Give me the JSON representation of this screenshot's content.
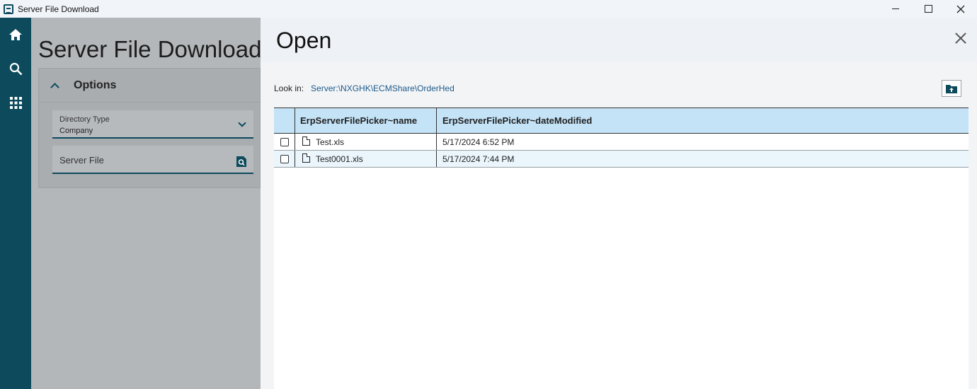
{
  "window": {
    "title": "Server File Download"
  },
  "rail": {
    "items": [
      {
        "icon": "home-icon"
      },
      {
        "icon": "search-icon"
      },
      {
        "icon": "apps-grid-icon"
      }
    ]
  },
  "page": {
    "title": "Server File Download",
    "options": {
      "label": "Options",
      "directory_type": {
        "label": "Directory Type",
        "value": "Company"
      },
      "server_file": {
        "placeholder": "Server File"
      }
    }
  },
  "dialog": {
    "title": "Open",
    "look_in_label": "Look in:",
    "look_in_path": "Server:\\NXGHK\\ECMShare\\OrderHed",
    "columns": [
      "ErpServerFilePicker~name",
      "ErpServerFilePicker~dateModified"
    ],
    "rows": [
      {
        "name": "Test.xls",
        "date": "5/17/2024 6:52 PM"
      },
      {
        "name": "Test0001.xls",
        "date": "5/17/2024 7:44 PM"
      }
    ]
  }
}
